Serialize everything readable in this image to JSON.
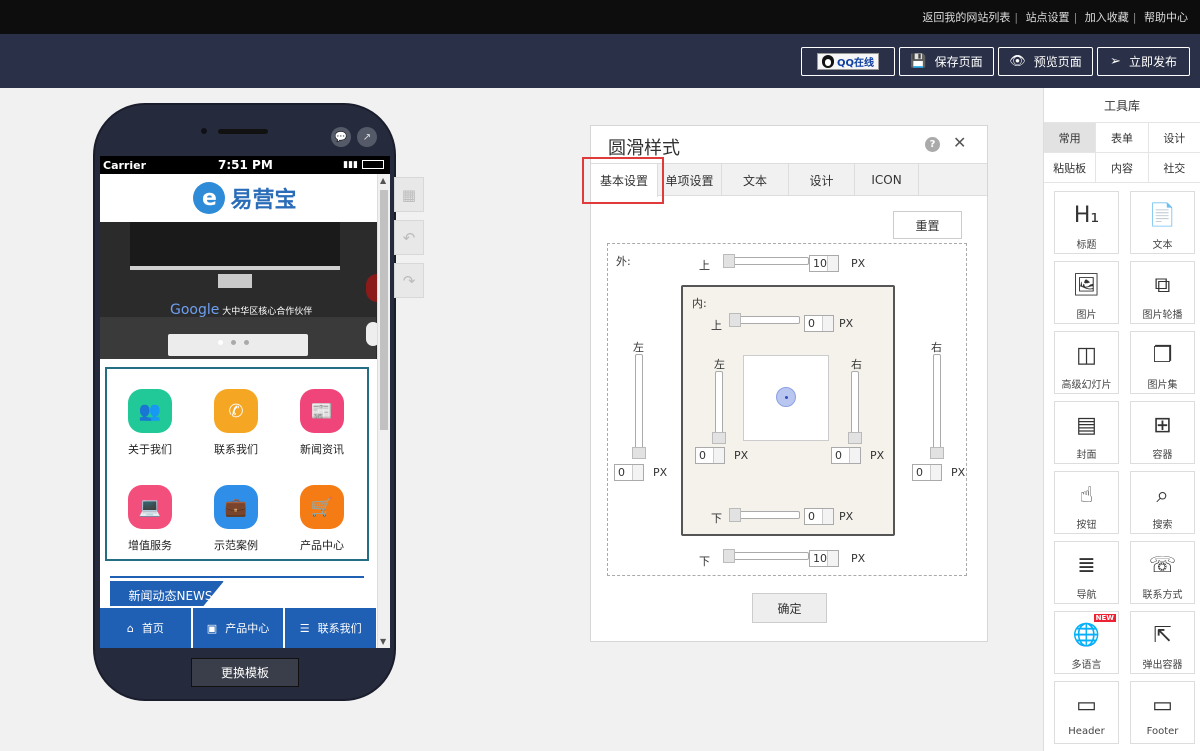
{
  "topbar": {
    "links": [
      "返回我的网站列表",
      "站点设置",
      "加入收藏",
      "帮助中心"
    ]
  },
  "toolbar": {
    "qq_label": "QQ在线",
    "save_label": "保存页面",
    "preview_label": "预览页面",
    "publish_label": "立即发布"
  },
  "phone": {
    "carrier": "Carrier",
    "time": "7:51 PM",
    "logo_text": "易营宝",
    "banner_text": "大中华区核心合作伙伴",
    "banner_brand": "Google",
    "grid": [
      {
        "label": "关于我们",
        "color": "#20c997",
        "icon": "users-icon",
        "glyph": "👥"
      },
      {
        "label": "联系我们",
        "color": "#f5a623",
        "icon": "phone-icon",
        "glyph": "✆"
      },
      {
        "label": "新闻资讯",
        "color": "#f0457a",
        "icon": "news-icon",
        "glyph": "📰"
      },
      {
        "label": "增值服务",
        "color": "#f34f7c",
        "icon": "laptop-icon",
        "glyph": "💻"
      },
      {
        "label": "示范案例",
        "color": "#2f8fe8",
        "icon": "briefcase-icon",
        "glyph": "💼"
      },
      {
        "label": "产品中心",
        "color": "#f57c15",
        "icon": "cart-icon",
        "glyph": "🛒"
      }
    ],
    "news_title": "新闻动态NEWS",
    "bottom_nav": [
      {
        "label": "首页",
        "icon": "home-icon",
        "glyph": "⌂"
      },
      {
        "label": "产品中心",
        "icon": "gallery-icon",
        "glyph": "▣"
      },
      {
        "label": "联系我们",
        "icon": "list-icon",
        "glyph": "☰"
      }
    ],
    "change_template": "更换模板"
  },
  "dialog": {
    "title": "圆滑样式",
    "tabs": [
      "基本设置",
      "单项设置",
      "文本",
      "设计",
      "ICON"
    ],
    "reset": "重置",
    "outer_label": "外:",
    "inner_label": "内:",
    "top": "上",
    "bottom": "下",
    "left": "左",
    "right": "右",
    "unit": "PX",
    "outer_top": "10",
    "outer_bottom": "10",
    "outer_left": "0",
    "outer_right": "0",
    "inner_top": "0",
    "inner_bottom": "0",
    "inner_left": "0",
    "inner_right": "0",
    "ok": "确定"
  },
  "library": {
    "title": "工具库",
    "tabs_row1": [
      "常用",
      "表单",
      "设计"
    ],
    "tabs_row2": [
      "粘贴板",
      "内容",
      "社交"
    ],
    "tiles": [
      {
        "label": "标题",
        "icon": "heading-icon",
        "glyph": "H₁"
      },
      {
        "label": "文本",
        "icon": "text-file-icon",
        "glyph": "📄"
      },
      {
        "label": "图片",
        "icon": "image-icon",
        "glyph": "🖼"
      },
      {
        "label": "图片轮播",
        "icon": "carousel-icon",
        "glyph": "⧉"
      },
      {
        "label": "高级幻灯片",
        "icon": "slideshow-icon",
        "glyph": "◫"
      },
      {
        "label": "图片集",
        "icon": "gallery-icon",
        "glyph": "❐"
      },
      {
        "label": "封面",
        "icon": "cover-icon",
        "glyph": "▤"
      },
      {
        "label": "容器",
        "icon": "container-icon",
        "glyph": "⊞"
      },
      {
        "label": "按钮",
        "icon": "button-pointer-icon",
        "glyph": "☝"
      },
      {
        "label": "搜索",
        "icon": "search-icon",
        "glyph": "⌕"
      },
      {
        "label": "导航",
        "icon": "nav-list-icon",
        "glyph": "≣"
      },
      {
        "label": "联系方式",
        "icon": "contact-icon",
        "glyph": "☏"
      },
      {
        "label": "多语言",
        "icon": "globe-icon",
        "glyph": "🌐",
        "badge": "NEW"
      },
      {
        "label": "弹出容器",
        "icon": "popup-icon",
        "glyph": "⇱"
      },
      {
        "label": "Header",
        "icon": "header-icon",
        "glyph": "▭"
      },
      {
        "label": "Footer",
        "icon": "footer-icon",
        "glyph": "▭"
      }
    ]
  }
}
